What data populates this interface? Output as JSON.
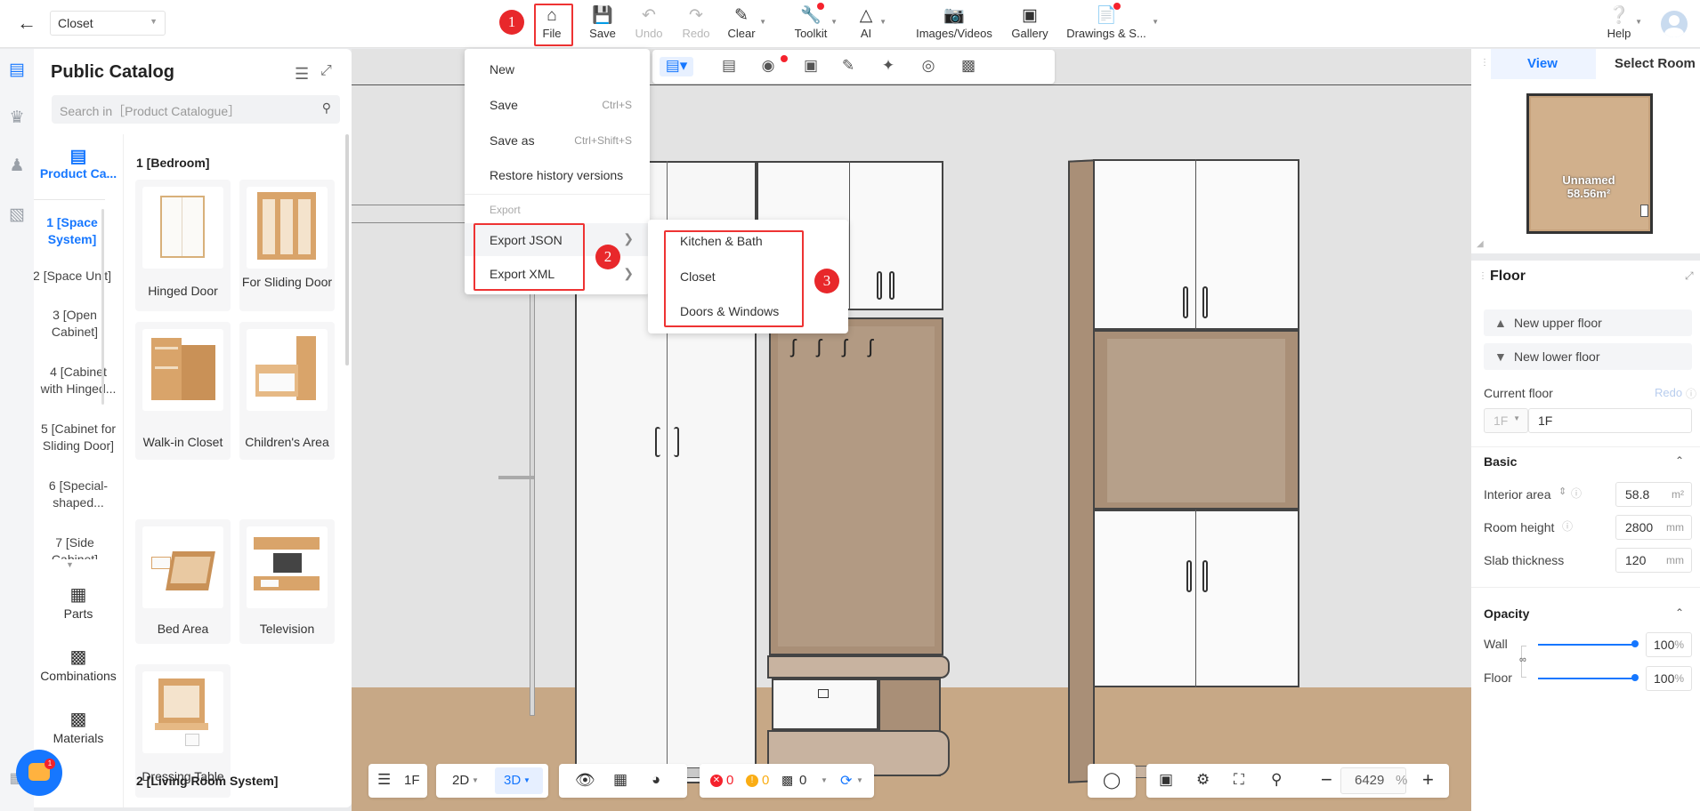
{
  "header": {
    "back_icon": "arrow-left-icon",
    "project": "Closet",
    "tools": [
      {
        "id": "file",
        "label": "File",
        "icon": "home-icon"
      },
      {
        "id": "save",
        "label": "Save",
        "icon": "save-icon"
      },
      {
        "id": "undo",
        "label": "Undo",
        "icon": "undo-icon"
      },
      {
        "id": "redo",
        "label": "Redo",
        "icon": "redo-icon"
      },
      {
        "id": "clear",
        "label": "Clear",
        "icon": "eraser-icon"
      },
      {
        "id": "toolkit",
        "label": "Toolkit",
        "icon": "wrench-icon"
      },
      {
        "id": "ai",
        "label": "AI",
        "icon": "ai-icon"
      },
      {
        "id": "images",
        "label": "Images/Videos",
        "icon": "camera-icon"
      },
      {
        "id": "gallery",
        "label": "Gallery",
        "icon": "gallery-icon"
      },
      {
        "id": "drawings",
        "label": "Drawings & S...",
        "icon": "drawings-icon"
      },
      {
        "id": "help",
        "label": "Help",
        "icon": "help-icon"
      }
    ]
  },
  "annotations": {
    "step1": "1",
    "step2": "2",
    "step3": "3"
  },
  "catalog": {
    "title": "Public Catalog",
    "search_placeholder": "Search in［Product Catalogue］",
    "tab_label": "Product Ca...",
    "categories": [
      "1 [Space System]",
      "2 [Space Unit]",
      "3 [Open Cabinet]",
      "4 [Cabinet with Hinged...",
      "5 [Cabinet for Sliding Door]",
      "6 [Special-shaped...",
      "7 [Side Cabinet]"
    ],
    "section1": "1 [Bedroom]",
    "items": [
      "Hinged Door",
      "For Sliding Door",
      "Walk-in Closet",
      "Children's Area",
      "Bed Area",
      "Television",
      "Dressing Table"
    ],
    "section2": "2 [Living Room System]",
    "bottom": [
      "Parts",
      "Combinations",
      "Materials"
    ],
    "chat_badge": "1"
  },
  "file_menu": {
    "items": [
      {
        "label": "New",
        "shortcut": ""
      },
      {
        "label": "Save",
        "shortcut": "Ctrl+S"
      },
      {
        "label": "Save as",
        "shortcut": "Ctrl+Shift+S"
      },
      {
        "label": "Restore history versions",
        "shortcut": ""
      }
    ],
    "export_header": "Export",
    "export_items": [
      "Export JSON",
      "Export XML"
    ],
    "submenu": [
      "Kitchen & Bath",
      "Closet",
      "Doors & Windows"
    ]
  },
  "minimap": {
    "tab_view": "View",
    "tab_select": "Select Room",
    "room_name": "Unnamed",
    "room_area": "58.56m²"
  },
  "floor_panel": {
    "title": "Floor",
    "new_upper": "New upper floor",
    "new_lower": "New lower floor",
    "current_floor_label": "Current floor",
    "redo": "Redo",
    "floor_select": "1F",
    "floor_name": "1F",
    "basic": "Basic",
    "interior_area_label": "Interior area",
    "interior_area": "58.8",
    "area_unit": "m²",
    "room_height_label": "Room height",
    "room_height": "2800",
    "slab_label": "Slab thickness",
    "slab": "120",
    "mm": "mm",
    "opacity": "Opacity",
    "wall_label": "Wall",
    "wall_value": "100",
    "floor_label": "Floor",
    "floor_value": "100",
    "pct": "%"
  },
  "bottom_bar": {
    "floor": "1F",
    "mode2d": "2D",
    "mode3d": "3D",
    "errors": "0",
    "warnings": "0",
    "other": "0",
    "zoom": "6429",
    "zoom_unit": "%"
  },
  "colors": {
    "accent": "#1677ff",
    "annotation": "#e8282b",
    "wall": "#e3e3e3",
    "wood": "#a98f77"
  }
}
